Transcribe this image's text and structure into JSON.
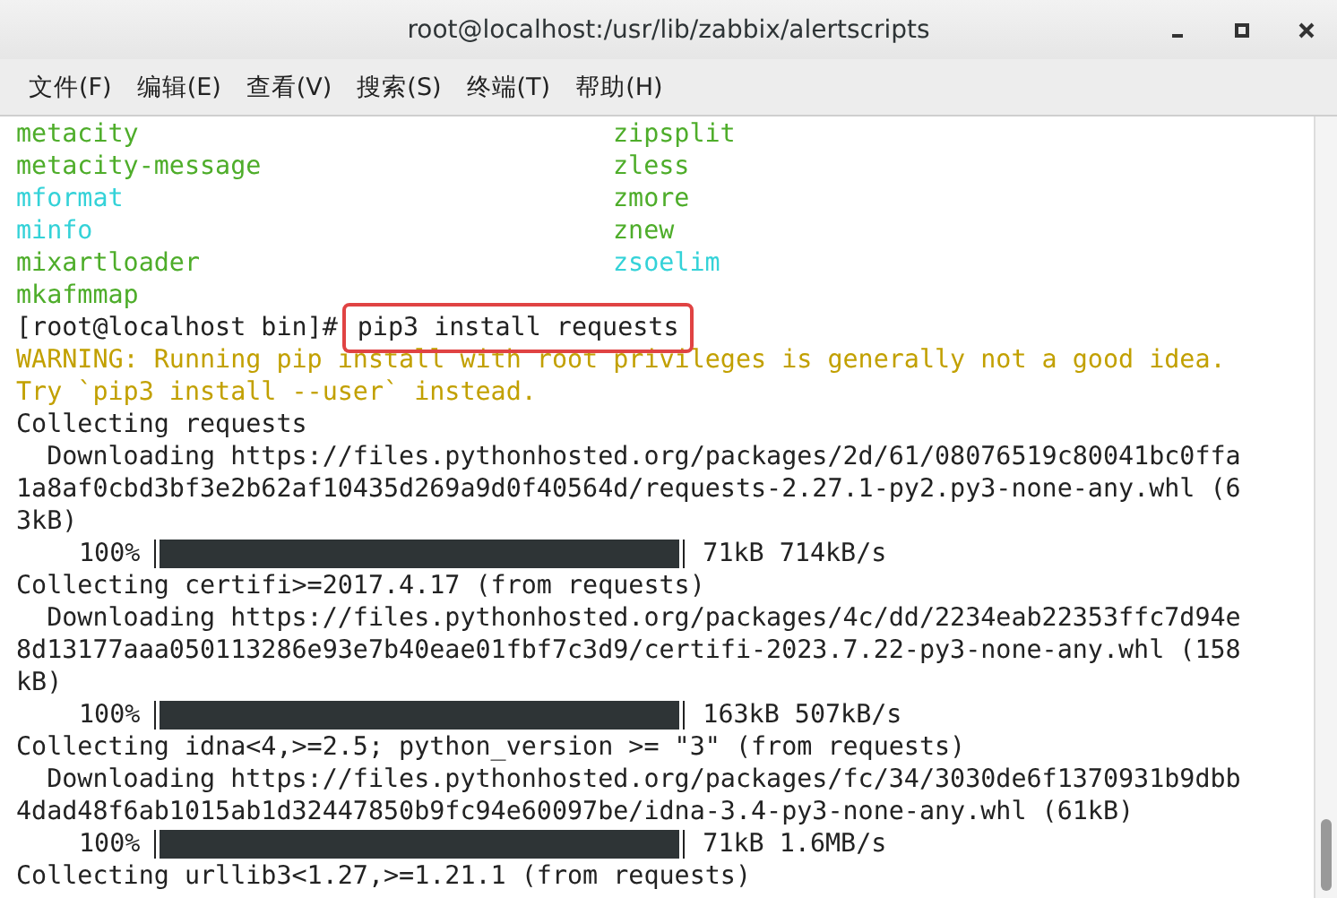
{
  "window": {
    "title": "root@localhost:/usr/lib/zabbix/alertscripts"
  },
  "menu": [
    "文件(F)",
    "编辑(E)",
    "查看(V)",
    "搜索(S)",
    "终端(T)",
    "帮助(H)"
  ],
  "terminal": {
    "lines": [
      {
        "kind": "listing",
        "entries": [
          {
            "name": "metacity",
            "color": "#4ead2a"
          },
          {
            "name": "zipsplit",
            "color": "#4ead2a"
          }
        ]
      },
      {
        "kind": "listing",
        "entries": [
          {
            "name": "metacity-message",
            "color": "#4ead2a"
          },
          {
            "name": "zless",
            "color": "#4ead2a"
          }
        ]
      },
      {
        "kind": "listing",
        "entries": [
          {
            "name": "mformat",
            "color": "#34d2d8"
          },
          {
            "name": "zmore",
            "color": "#4ead2a"
          }
        ]
      },
      {
        "kind": "listing",
        "entries": [
          {
            "name": "minfo",
            "color": "#34d2d8"
          },
          {
            "name": "znew",
            "color": "#4ead2a"
          }
        ]
      },
      {
        "kind": "listing",
        "entries": [
          {
            "name": "mixartloader",
            "color": "#4ead2a"
          },
          {
            "name": "zsoelim",
            "color": "#34d2d8"
          }
        ]
      },
      {
        "kind": "listing",
        "entries": [
          {
            "name": "mkafmmap",
            "color": "#4ead2a"
          }
        ]
      },
      {
        "kind": "prompt",
        "prompt": "[root@localhost bin]#",
        "command": "pip3 install requests",
        "highlighted": true
      },
      {
        "kind": "warning",
        "text": "WARNING: Running pip install with root privileges is generally not a good idea."
      },
      {
        "kind": "warning",
        "text": "Try `pip3 install --user` instead."
      },
      {
        "kind": "plain",
        "text": "Collecting requests"
      },
      {
        "kind": "plain",
        "text": "  Downloading https://files.pythonhosted.org/packages/2d/61/08076519c80041bc0ffa"
      },
      {
        "kind": "plain",
        "text": "1a8af0cbd3bf3e2b62af10435d269a9d0f40564d/requests-2.27.1-py2.py3-none-any.whl (6"
      },
      {
        "kind": "plain",
        "text": "3kB)"
      },
      {
        "kind": "progress",
        "percent": "100%",
        "level": 1,
        "info": "71kB 714kB/s"
      },
      {
        "kind": "plain",
        "text": "Collecting certifi>=2017.4.17 (from requests)"
      },
      {
        "kind": "plain",
        "text": "  Downloading https://files.pythonhosted.org/packages/4c/dd/2234eab22353ffc7d94e"
      },
      {
        "kind": "plain",
        "text": "8d13177aaa050113286e93e7b40eae01fbf7c3d9/certifi-2023.7.22-py3-none-any.whl (158"
      },
      {
        "kind": "plain",
        "text": "kB)"
      },
      {
        "kind": "progress",
        "percent": "100%",
        "level": 1,
        "info": "163kB 507kB/s"
      },
      {
        "kind": "plain",
        "text": "Collecting idna<4,>=2.5; python_version >= \"3\" (from requests)"
      },
      {
        "kind": "plain",
        "text": "  Downloading https://files.pythonhosted.org/packages/fc/34/3030de6f1370931b9dbb"
      },
      {
        "kind": "plain",
        "text": "4dad48f6ab1015ab1d32447850b9fc94e60097be/idna-3.4-py3-none-any.whl (61kB)"
      },
      {
        "kind": "progress",
        "percent": "100%",
        "level": 1,
        "info": "71kB 1.6MB/s"
      },
      {
        "kind": "plain",
        "text": "Collecting urllib3<1.27,>=1.21.1 (from requests)"
      }
    ]
  }
}
